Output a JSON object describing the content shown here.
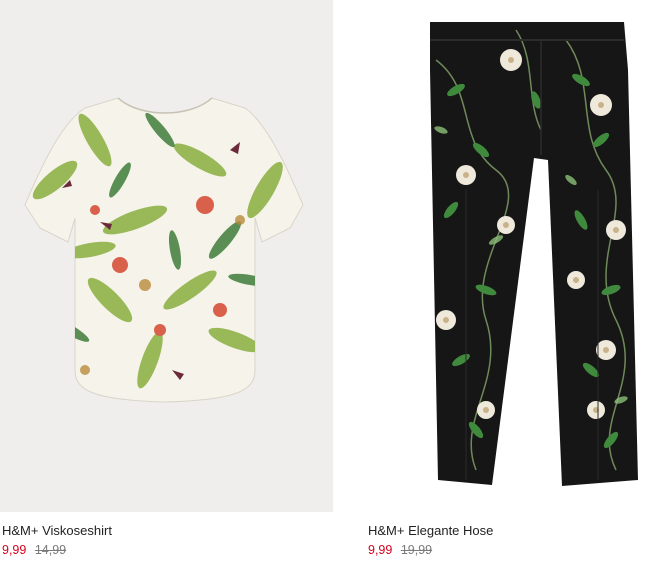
{
  "products": [
    {
      "name": "H&M+ Viskoseshirt",
      "price_sale": "9,99",
      "price_original": "14,99",
      "image": "floral-print-shirt-image",
      "colors": {
        "background": "#efeeec",
        "fabric": "#f6f3ea",
        "leaf": "#8fb34a",
        "accent": "#d9604a"
      }
    },
    {
      "name": "H&M+ Elegante Hose",
      "price_sale": "9,99",
      "price_original": "19,99",
      "image": "floral-print-trousers-image",
      "colors": {
        "background": "#ffffff",
        "fabric": "#161616",
        "leaf": "#3f8a3c",
        "flower": "#efe9dc"
      }
    }
  ],
  "colors": {
    "sale_price": "#d6001c",
    "old_price": "#7a7a7a",
    "text": "#222222"
  }
}
